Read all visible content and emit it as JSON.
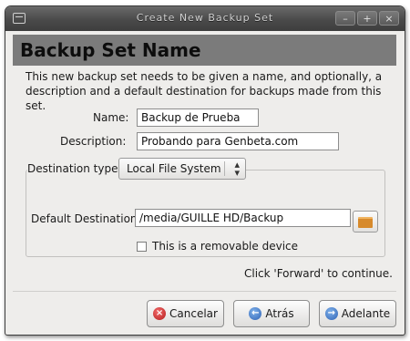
{
  "window": {
    "title": "Create New Backup Set",
    "controls": {
      "minimize": "–",
      "maximize": "+",
      "close": "×"
    }
  },
  "header": {
    "title": "Backup Set Name"
  },
  "intro": {
    "line1": "This new backup set needs to be given a name, and optionally, a",
    "line2": "description and a default destination for backups made from this set."
  },
  "form": {
    "name_label": "Name:",
    "name_value": "Backup de Prueba",
    "description_label": "Description:",
    "description_value": "Probando para Genbeta.com",
    "destination_type_label": "Destination type:",
    "destination_type_value": "Local File System",
    "default_destination_label": "Default Destination:",
    "default_destination_value": "/media/GUILLE HD/Backup",
    "removable_label": "This is a removable device",
    "removable_checked": false
  },
  "hint": "Click 'Forward' to continue.",
  "buttons": {
    "cancel": "Cancelar",
    "back": "Atrás",
    "forward": "Adelante"
  },
  "icons": {
    "cancel": "cancel-icon",
    "back": "back-arrow-icon",
    "forward": "forward-arrow-icon",
    "folder": "folder-icon"
  }
}
